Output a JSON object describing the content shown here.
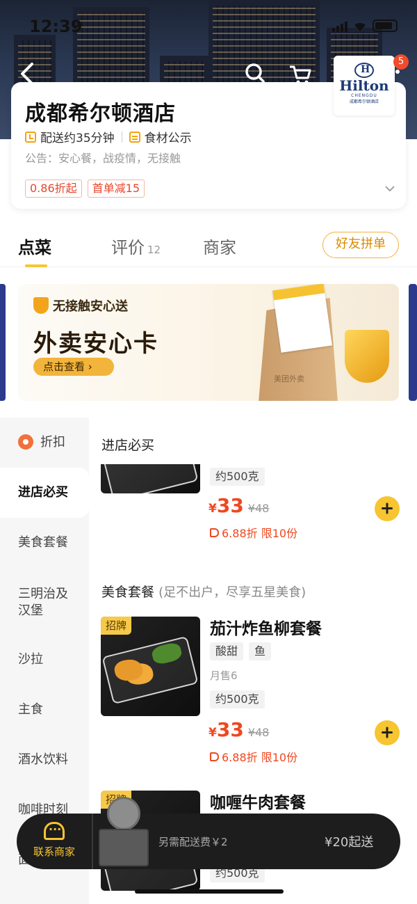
{
  "status_bar": {
    "time": "12:39"
  },
  "store": {
    "name": "成都希尔顿酒店",
    "delivery_time": "配送约35分钟",
    "ingredients_label": "食材公示",
    "notice": "公告：安心餐，战疫情，无接触",
    "promos": [
      "0.86折起",
      "首单减15"
    ],
    "logo": {
      "brand": "Hilton",
      "city": "CHENGDU",
      "cn": "成都希尔顿酒店"
    },
    "cart_badge": "5"
  },
  "tabs": [
    {
      "label": "点菜",
      "active": true
    },
    {
      "label": "评价",
      "count": "12"
    },
    {
      "label": "商家"
    }
  ],
  "group_order_button": "好友拼单",
  "banner": {
    "badge": "无接触安心送",
    "title": "外卖安心卡",
    "button": "点击查看 ›",
    "bag_text": "美团外卖"
  },
  "categories": [
    {
      "label": "折扣",
      "icon": "discount-icon"
    },
    {
      "label": "进店必买",
      "active": true
    },
    {
      "label": "美食套餐"
    },
    {
      "label": "三明治及汉堡"
    },
    {
      "label": "沙拉"
    },
    {
      "label": "主食"
    },
    {
      "label": "酒水饮料"
    },
    {
      "label": "咖啡时刻"
    },
    {
      "label": "面"
    }
  ],
  "sections": {
    "must_buy": {
      "title": "进店必买",
      "item": {
        "weight": "约500克",
        "price": "33",
        "original_price": "¥48",
        "discount": "6.88折 限10份"
      }
    },
    "combo": {
      "title": "美食套餐",
      "subtitle": "(足不出户，尽享五星美食)",
      "items": [
        {
          "tag": "招牌",
          "name": "茄汁炸鱼柳套餐",
          "chips": [
            "酸甜",
            "鱼"
          ],
          "monthly_sales": "月售6",
          "weight": "约500克",
          "price": "33",
          "original_price": "¥48",
          "discount": "6.88折 限10份"
        },
        {
          "tag": "招牌",
          "name": "咖喱牛肉套餐",
          "weight": "约500克"
        }
      ]
    }
  },
  "currency_symbol": "¥",
  "bottom_bar": {
    "contact_label": "联系商家",
    "delivery_fee": "另需配送费￥2",
    "min_order": "¥20起送"
  }
}
